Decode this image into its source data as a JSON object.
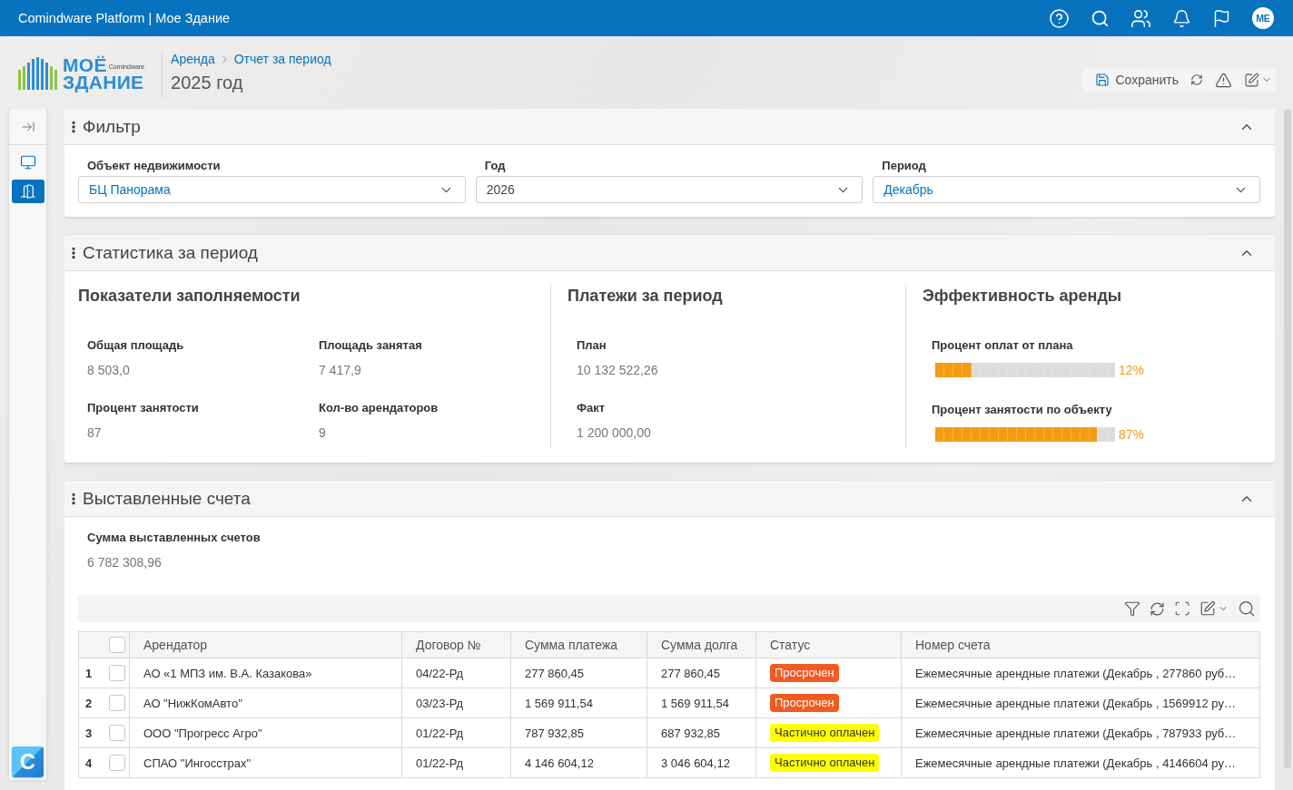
{
  "top_bar": {
    "title": "Comindware Platform | Мое Здание",
    "avatar_initials": "ME"
  },
  "logo": {
    "line_1": "МОЁ",
    "brand": "Comindware",
    "line_2": "ЗДАНИЕ"
  },
  "breadcrumbs": [
    "Аренда",
    "Отчет за период"
  ],
  "page_title": "2025 год",
  "toolbar": {
    "save_label": "Сохранить"
  },
  "sidebar": {
    "items": [
      {
        "selected": false
      },
      {
        "selected": true
      }
    ],
    "app_badge": "C"
  },
  "filter_panel": {
    "title": "Фильтр",
    "expanded": true,
    "fields": [
      {
        "label": "Объект недвижимости",
        "value": "БЦ Панорама",
        "kind": "reference"
      },
      {
        "label": "Год",
        "value": "2026",
        "kind": "plain"
      },
      {
        "label": "Период",
        "value": "Декабрь",
        "kind": "reference"
      }
    ]
  },
  "stats_panel": {
    "title": "Статистика за период",
    "expanded": true,
    "sections": [
      {
        "kind": "fields",
        "title": "Показатели заполняемости",
        "fields": [
          {
            "label": "Общая площадь",
            "value": "8 503,0"
          },
          {
            "label": "Площадь занятая",
            "value": "7 417,9"
          },
          {
            "label": "Процент занятости",
            "value": "87"
          },
          {
            "label": "Кол-во арендаторов",
            "value": "9"
          }
        ]
      },
      {
        "kind": "fields",
        "title": "Платежи за период",
        "fields": [
          {
            "label": "План",
            "value": "10 132 522,26"
          },
          {
            "label": "Факт",
            "value": "1 200 000,00"
          }
        ]
      },
      {
        "kind": "meters",
        "title": "Эффективность аренды",
        "meters": [
          {
            "label": "Процент оплат от плана",
            "level": 0.2,
            "reading": "12%"
          },
          {
            "label": "Процент занятости по объекту",
            "level": 0.9,
            "reading": "87%"
          }
        ]
      }
    ]
  },
  "invoices_panel": {
    "title": "Выставленные счета",
    "expanded": true,
    "summary": {
      "label": "Сумма выставленных счетов",
      "value": "6 782 308,96"
    },
    "table": {
      "all_checked": false,
      "columns": [
        "Арендатор",
        "Договор №",
        "Сумма платежа",
        "Сумма долга",
        "Статус",
        "Номер счета"
      ],
      "rows": [
        {
          "number": "1",
          "checked": false,
          "tenant": "АО «1 МПЗ им. В.А. Казакова»",
          "contract": "04/22-Рд",
          "payment": "277 860,45",
          "debt": "277 860,45",
          "status": {
            "text": "Просрочен",
            "color": "#f15a22"
          },
          "invoice": "Ежемесячные арендные платежи (Декабрь , 277860 руб…"
        },
        {
          "number": "2",
          "checked": false,
          "tenant": "АО \"НижКомАвто\"",
          "contract": "03/23-Рд",
          "payment": "1 569 911,54",
          "debt": "1 569 911,54",
          "status": {
            "text": "Просрочен",
            "color": "#f15a22"
          },
          "invoice": "Ежемесячные арендные платежи (Декабрь , 1569912 ру…"
        },
        {
          "number": "3",
          "checked": false,
          "tenant": "ООО \"Прогресс Агро\"",
          "contract": "01/22-Рд",
          "payment": "787 932,85",
          "debt": "687 932,85",
          "status": {
            "text": "Частично оплачен",
            "color": "#ffff00"
          },
          "invoice": "Ежемесячные арендные платежи (Декабрь , 787933 руб…"
        },
        {
          "number": "4",
          "checked": false,
          "tenant": "СПАО \"Ингосстрах\"",
          "contract": "01/22-Рд",
          "payment": "4 146 604,12",
          "debt": "3 046 604,12",
          "status": {
            "text": "Частично оплачен",
            "color": "#ffff00"
          },
          "invoice": "Ежемесячные арендные платежи (Декабрь , 4146604 ру…"
        }
      ]
    }
  }
}
